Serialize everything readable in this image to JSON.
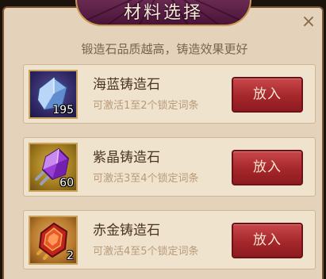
{
  "dialog": {
    "title": "材料选择",
    "close_icon": "×",
    "subtitle": "锻造石品质越高，铸造效果更好"
  },
  "items": [
    {
      "name": "海蓝铸造石",
      "description": "可激活1至2个锁定词条",
      "count": "195",
      "button": "放入",
      "icon": "blue-crystal-icon"
    },
    {
      "name": "紫晶铸造石",
      "description": "可激活3至4个锁定词条",
      "count": "60",
      "button": "放入",
      "icon": "purple-crystal-icon"
    },
    {
      "name": "赤金铸造石",
      "description": "可激活4至5个锁定词条",
      "count": "2",
      "button": "放入",
      "icon": "red-gold-crystal-icon"
    }
  ],
  "colors": {
    "panel": "#e4d3ba",
    "title_plaque": "#5a1e45",
    "button": "#a5272b",
    "description_text": "#b89a7a"
  }
}
